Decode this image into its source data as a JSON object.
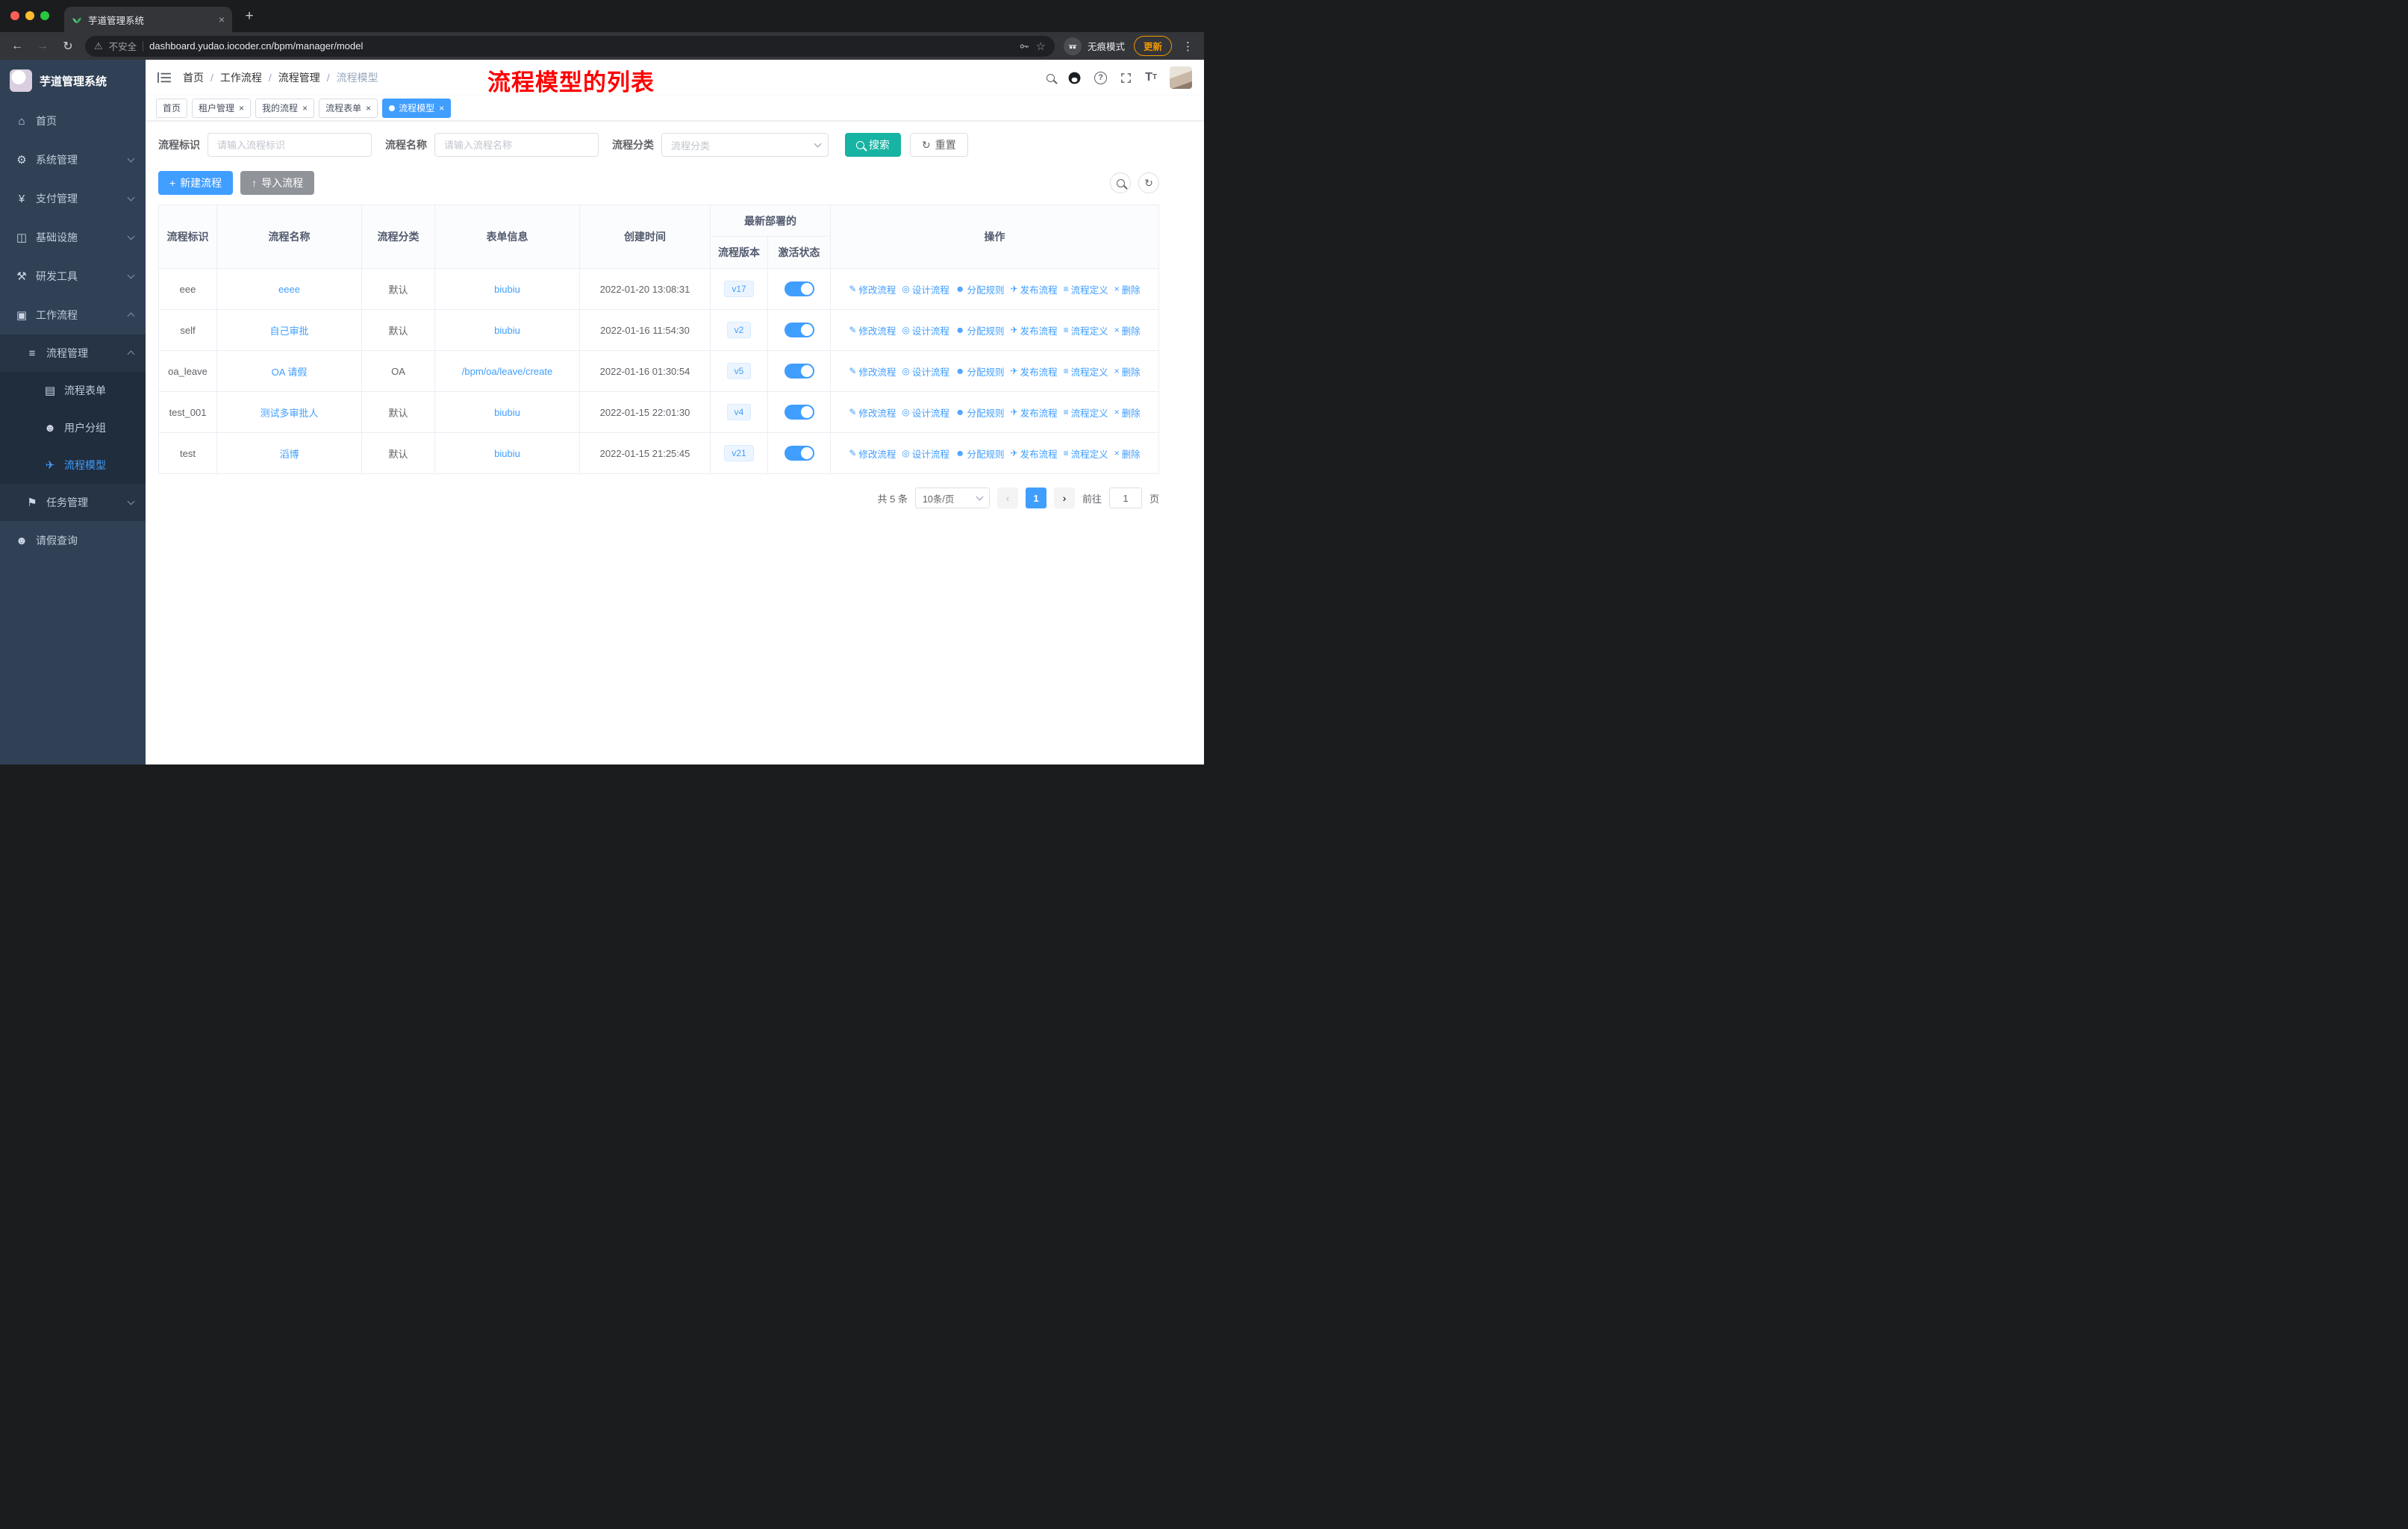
{
  "colors": {
    "primary": "#409eff",
    "search_button": "#17b3a3",
    "annotation": "#ff0000",
    "sidebar_bg": "#304156",
    "import_button": "#909399"
  },
  "browser": {
    "tab_title": "芋道管理系统",
    "security_label": "不安全",
    "url": "dashboard.yudao.iocoder.cn/bpm/manager/model",
    "incognito_label": "无痕模式",
    "update_label": "更新"
  },
  "icons": {
    "home": "⌂",
    "system": "⚙",
    "payment": "¥",
    "infra": "◫",
    "devtools": "⚒",
    "workflow": "▣",
    "flow-manage": "≡",
    "flow-form": "▤",
    "user-group": "☻",
    "flow-model": "✈",
    "task-manage": "⚑",
    "leave-query": "☻",
    "edit": "✎",
    "design": "◎",
    "assign": "☻",
    "publish": "✈",
    "definition": "≡",
    "delete": "×",
    "plus": "+",
    "upload": "↑",
    "refresh": "↻",
    "back": "←",
    "forward": "→",
    "reload": "↻",
    "warning": "⚠",
    "star": "☆",
    "dots_vertical": "⋮",
    "close": "×",
    "new_tab": "+",
    "prev": "‹",
    "next": "›",
    "help": "?",
    "font_size_big": "T",
    "font_size_small": "T"
  },
  "sidebar": {
    "logo_title": "芋道管理系统",
    "items": [
      {
        "name": "home",
        "label": "首页",
        "icon": "home",
        "level": 1
      },
      {
        "name": "system-manage",
        "label": "系统管理",
        "icon": "system",
        "level": 1,
        "chevron": "down"
      },
      {
        "name": "payment-manage",
        "label": "支付管理",
        "icon": "payment",
        "level": 1,
        "chevron": "down"
      },
      {
        "name": "infrastructure",
        "label": "基础设施",
        "icon": "infra",
        "level": 1,
        "chevron": "down"
      },
      {
        "name": "dev-tools",
        "label": "研发工具",
        "icon": "devtools",
        "level": 1,
        "chevron": "down"
      },
      {
        "name": "workflow",
        "label": "工作流程",
        "icon": "workflow",
        "level": 1,
        "chevron": "up"
      },
      {
        "name": "flow-manage",
        "label": "流程管理",
        "icon": "flow-manage",
        "level": 2,
        "chevron": "up"
      },
      {
        "name": "flow-form",
        "label": "流程表单",
        "icon": "flow-form",
        "level": 3
      },
      {
        "name": "user-group",
        "label": "用户分组",
        "icon": "user-group",
        "level": 3
      },
      {
        "name": "flow-model",
        "label": "流程模型",
        "icon": "flow-model",
        "level": 3,
        "active": true
      },
      {
        "name": "task-manage",
        "label": "任务管理",
        "icon": "task-manage",
        "level": 2,
        "chevron": "down"
      },
      {
        "name": "leave-query",
        "label": "请假查询",
        "icon": "leave-query",
        "level": 1
      }
    ]
  },
  "header": {
    "breadcrumb": [
      "首页",
      "工作流程",
      "流程管理",
      "流程模型"
    ],
    "annotation": "流程模型的列表"
  },
  "tabs": [
    {
      "name": "home",
      "label": "首页",
      "closable": false,
      "active": false
    },
    {
      "name": "tenant-manage",
      "label": "租户管理",
      "closable": true,
      "active": false
    },
    {
      "name": "my-flow",
      "label": "我的流程",
      "closable": true,
      "active": false
    },
    {
      "name": "flow-form",
      "label": "流程表单",
      "closable": true,
      "active": false
    },
    {
      "name": "flow-model",
      "label": "流程模型",
      "closable": true,
      "active": true
    }
  ],
  "filters": {
    "fields": [
      {
        "label": "流程标识",
        "placeholder": "请输入流程标识"
      },
      {
        "label": "流程名称",
        "placeholder": "请输入流程名称"
      },
      {
        "label": "流程分类",
        "placeholder": "流程分类"
      }
    ],
    "search_label": "搜索",
    "reset_label": "重置"
  },
  "toolbar": {
    "create_label": "新建流程",
    "import_label": "导入流程"
  },
  "table": {
    "columns": [
      "流程标识",
      "流程名称",
      "流程分类",
      "表单信息",
      "创建时间"
    ],
    "group_header": "最新部署的",
    "sub_columns": [
      "流程版本",
      "激活状态"
    ],
    "op_column": "操作",
    "row_actions": [
      {
        "name": "modify-flow",
        "label": "修改流程",
        "icon": "edit"
      },
      {
        "name": "design-flow",
        "label": "设计流程",
        "icon": "design"
      },
      {
        "name": "assign-rule",
        "label": "分配规则",
        "icon": "assign"
      },
      {
        "name": "publish-flow",
        "label": "发布流程",
        "icon": "publish"
      },
      {
        "name": "flow-definition",
        "label": "流程定义",
        "icon": "definition"
      },
      {
        "name": "delete",
        "label": "删除",
        "icon": "delete"
      }
    ],
    "rows": [
      {
        "id": "eee",
        "name": "eeee",
        "category": "默认",
        "form": "biubiu",
        "created": "2022-01-20 13:08:31",
        "version": "v17",
        "active": true
      },
      {
        "id": "self",
        "name": "自己审批",
        "category": "默认",
        "form": "biubiu",
        "created": "2022-01-16 11:54:30",
        "version": "v2",
        "active": true
      },
      {
        "id": "oa_leave",
        "name": "OA 请假",
        "category": "OA",
        "form": "/bpm/oa/leave/create",
        "created": "2022-01-16 01:30:54",
        "version": "v5",
        "active": true
      },
      {
        "id": "test_001",
        "name": "测试多审批人",
        "category": "默认",
        "form": "biubiu",
        "created": "2022-01-15 22:01:30",
        "version": "v4",
        "active": true
      },
      {
        "id": "test",
        "name": "滔博",
        "category": "默认",
        "form": "biubiu",
        "created": "2022-01-15 21:25:45",
        "version": "v21",
        "active": true
      }
    ]
  },
  "pagination": {
    "total": "共 5 条",
    "page_size": "10条/页",
    "current": "1",
    "goto_label": "前往",
    "goto_value": "1",
    "unit_label": "页"
  }
}
